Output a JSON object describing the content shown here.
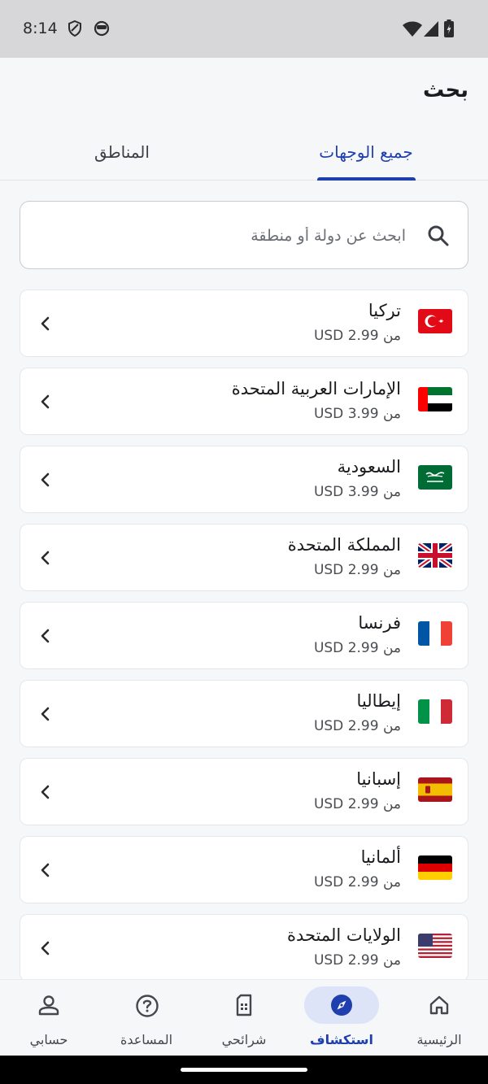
{
  "status_bar": {
    "time": "8:14"
  },
  "header": {
    "title": "بحث"
  },
  "tabs": [
    {
      "label": "جميع الوجهات",
      "active": true
    },
    {
      "label": "المناطق",
      "active": false
    }
  ],
  "search": {
    "placeholder": "ابحث عن دولة أو منطقة",
    "value": ""
  },
  "destinations": [
    {
      "name": "تركيا",
      "price": "من 2.99 USD",
      "flag": "turkey-flag-icon"
    },
    {
      "name": "الإمارات العربية المتحدة",
      "price": "من 3.99 USD",
      "flag": "uae-flag-icon"
    },
    {
      "name": "السعودية",
      "price": "من 3.99 USD",
      "flag": "saudi-flag-icon"
    },
    {
      "name": "المملكة المتحدة",
      "price": "من 2.99 USD",
      "flag": "uk-flag-icon"
    },
    {
      "name": "فرنسا",
      "price": "من 2.99 USD",
      "flag": "france-flag-icon"
    },
    {
      "name": "إيطاليا",
      "price": "من 2.99 USD",
      "flag": "italy-flag-icon"
    },
    {
      "name": "إسبانيا",
      "price": "من 2.99 USD",
      "flag": "spain-flag-icon"
    },
    {
      "name": "ألمانيا",
      "price": "من 2.99 USD",
      "flag": "germany-flag-icon"
    },
    {
      "name": "الولايات المتحدة",
      "price": "من 2.99 USD",
      "flag": "usa-flag-icon"
    }
  ],
  "bottom_nav": [
    {
      "label": "الرئيسية",
      "icon": "home-icon",
      "active": false
    },
    {
      "label": "استكشاف",
      "icon": "compass-icon",
      "active": true
    },
    {
      "label": "شرائحي",
      "icon": "sim-card-icon",
      "active": false
    },
    {
      "label": "المساعدة",
      "icon": "help-icon",
      "active": false
    },
    {
      "label": "حسابي",
      "icon": "person-icon",
      "active": false
    }
  ],
  "colors": {
    "accent": "#1f3fae",
    "accent_pill": "#dde4f8",
    "background": "#f6f7f9"
  }
}
